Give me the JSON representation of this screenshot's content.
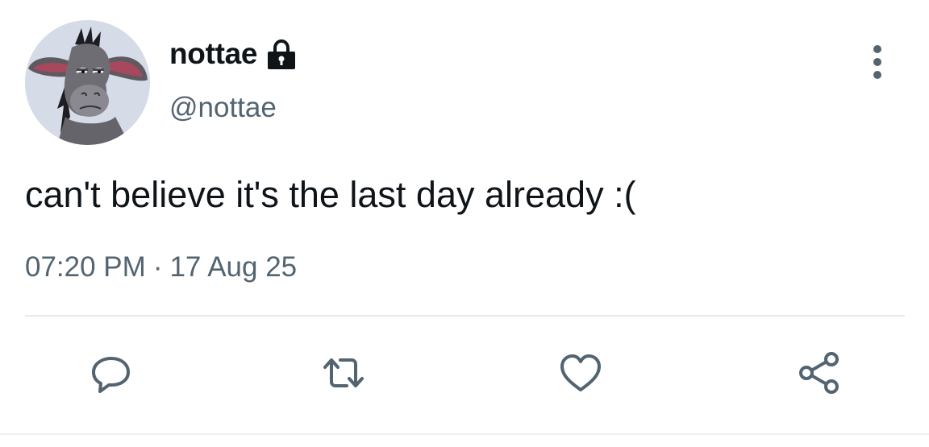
{
  "author": {
    "display_name": "nottae",
    "handle": "@nottae",
    "avatar_icon": "donkey-avatar-icon",
    "protected_icon": "lock-icon"
  },
  "tweet": {
    "text": "can't believe it's the last day already :(",
    "time": "07:20 PM",
    "separator": "·",
    "date": "17 Aug 25"
  },
  "actions": [
    {
      "name": "reply",
      "icon": "reply-icon"
    },
    {
      "name": "retweet",
      "icon": "retweet-icon"
    },
    {
      "name": "like",
      "icon": "heart-icon"
    },
    {
      "name": "share",
      "icon": "share-icon"
    }
  ],
  "colors": {
    "text": "#0f1419",
    "secondary": "#536471",
    "divider": "#e6e9ec"
  }
}
